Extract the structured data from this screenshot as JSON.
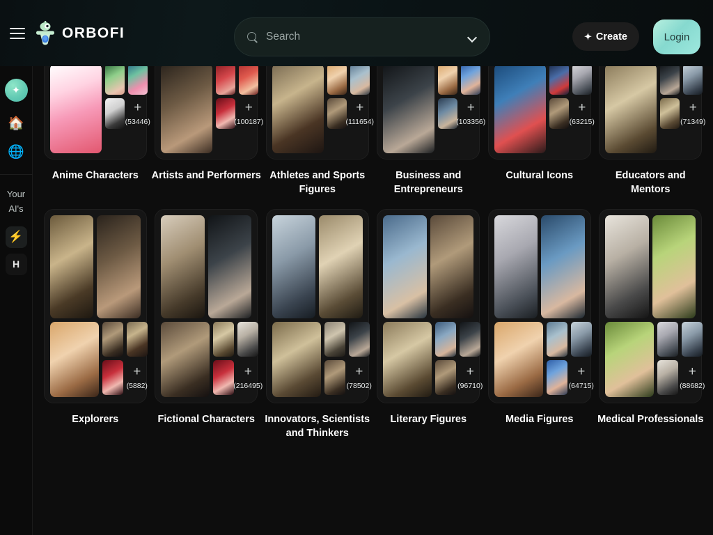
{
  "header": {
    "brand_name": "ORBOFI",
    "menu_icon": "hamburger-icon",
    "logo_icon": "orbofi-robot-logo",
    "search": {
      "placeholder": "Search",
      "value": "",
      "icon": "search-icon",
      "dropdown_icon": "chevron-down-icon"
    },
    "create_label": "Create",
    "create_icon": "sparkle-icon",
    "login_label": "Login"
  },
  "sidebar": {
    "orb_icon": "sparkles-orb-icon",
    "home_icon": "house-icon",
    "globe_icon": "globe-icon",
    "section_label": "Your AI's",
    "items": [
      {
        "icon": "lightning-bolt-icon",
        "label": "",
        "active": true
      },
      {
        "icon": "",
        "label": "H",
        "active": false
      }
    ]
  },
  "main": {
    "rows": [
      {
        "layout": "compact",
        "cards": [
          {
            "label": "Anime Characters",
            "count": "(53446)",
            "plus": "+"
          },
          {
            "label": "Artists and Performers",
            "count": "(100187)",
            "plus": "+"
          },
          {
            "label": "Athletes and Sports Figures",
            "count": "(111654)",
            "plus": "+"
          },
          {
            "label": "Business and Entrepreneurs",
            "count": "(103356)",
            "plus": "+"
          },
          {
            "label": "Cultural Icons",
            "count": "(63215)",
            "plus": "+"
          },
          {
            "label": "Educators and Mentors",
            "count": "(71349)",
            "plus": "+"
          }
        ]
      },
      {
        "layout": "tall",
        "cards": [
          {
            "label": "Explorers",
            "count": "(5882)",
            "plus": "+"
          },
          {
            "label": "Fictional Characters",
            "count": "(216495)",
            "plus": "+"
          },
          {
            "label": "Innovators, Scientists and Thinkers",
            "count": "(78502)",
            "plus": "+"
          },
          {
            "label": "Literary Figures",
            "count": "(96710)",
            "plus": "+"
          },
          {
            "label": "Media Figures",
            "count": "(64715)",
            "plus": "+"
          },
          {
            "label": "Medical Professionals",
            "count": "(88682)",
            "plus": "+"
          }
        ]
      }
    ]
  },
  "colors": {
    "page_bg": "#0d0d0d",
    "header_bg": "#0c1416",
    "card_bg": "#151515",
    "accent_mint": "#9ee8de",
    "accent_teal": "#3fd6c4",
    "text_primary": "#ffffff",
    "text_muted": "#9aa5a3"
  }
}
